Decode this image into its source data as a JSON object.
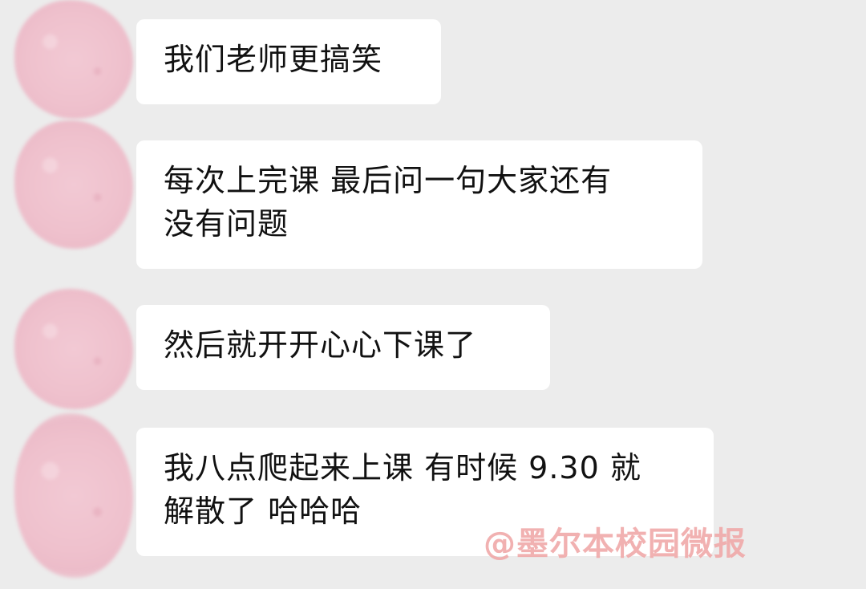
{
  "messages": [
    {
      "text": "我们老师更搞笑"
    },
    {
      "text": "每次上完课 最后问一句大家还有\n没有问题"
    },
    {
      "text": "然后就开开心心下课了"
    },
    {
      "text": "我八点爬起来上课 有时候 9.30 就\n解散了 哈哈哈"
    }
  ],
  "watermark": "@墨尔本校园微报"
}
